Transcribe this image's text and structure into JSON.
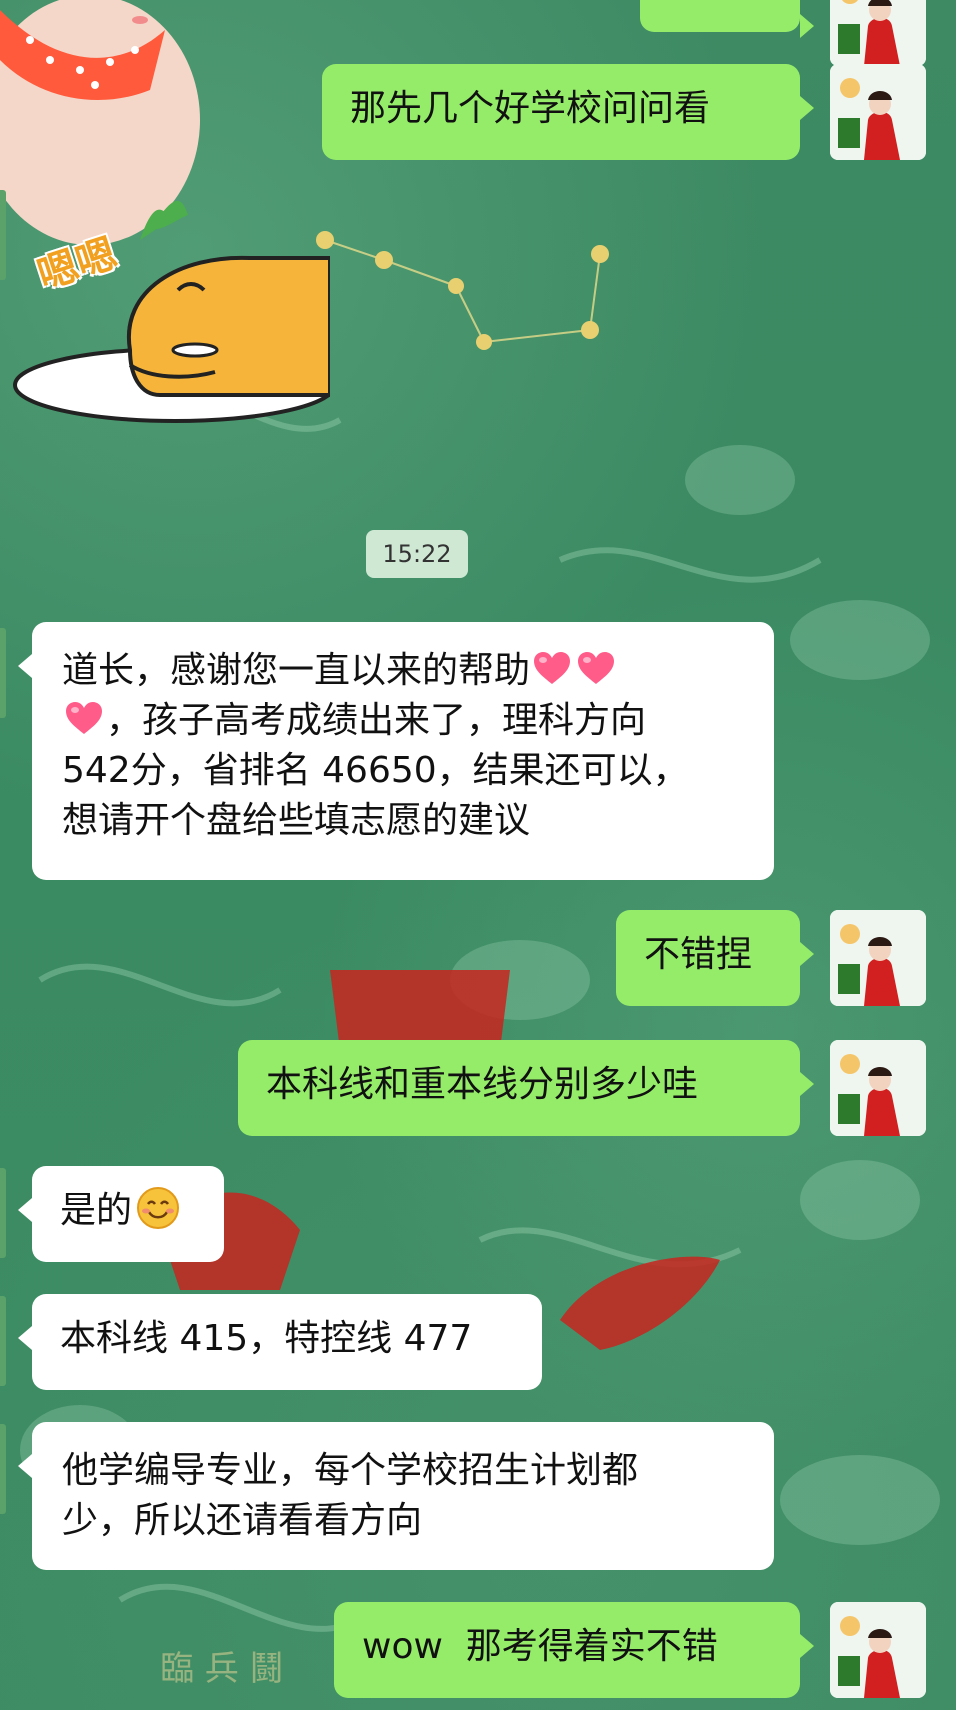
{
  "sticker": {
    "text": "嗯嗯"
  },
  "timestamp": "15:22",
  "messages": [
    {
      "id": "m1",
      "side": "out",
      "text": "那先几个好学校问问看"
    },
    {
      "id": "m2",
      "side": "in",
      "line1": "道长，感谢您一直以来的帮助",
      "line2": "，孩子高考成绩出来了，理科方向",
      "line3": "542分，省排名 46650，结果还可以，",
      "line4": "想请开个盘给些填志愿的建议"
    },
    {
      "id": "m3",
      "side": "out",
      "text": "不错捏"
    },
    {
      "id": "m4",
      "side": "out",
      "text": "本科线和重本线分别多少哇"
    },
    {
      "id": "m5",
      "side": "in",
      "text": "是的"
    },
    {
      "id": "m6",
      "side": "in",
      "text": "本科线 415，特控线 477"
    },
    {
      "id": "m7",
      "side": "in",
      "line1": "他学编导专业，每个学校招生计划都",
      "line2": "少，所以还请看看方向"
    },
    {
      "id": "m8",
      "side": "out",
      "text": "wow  那考得着实不错"
    }
  ],
  "colors": {
    "outgoing_bubble": "#95ec69",
    "incoming_bubble": "#ffffff",
    "background": "#3f8a62"
  },
  "icons": {
    "heart": "heart-emoji",
    "smile": "smile-emoji"
  }
}
